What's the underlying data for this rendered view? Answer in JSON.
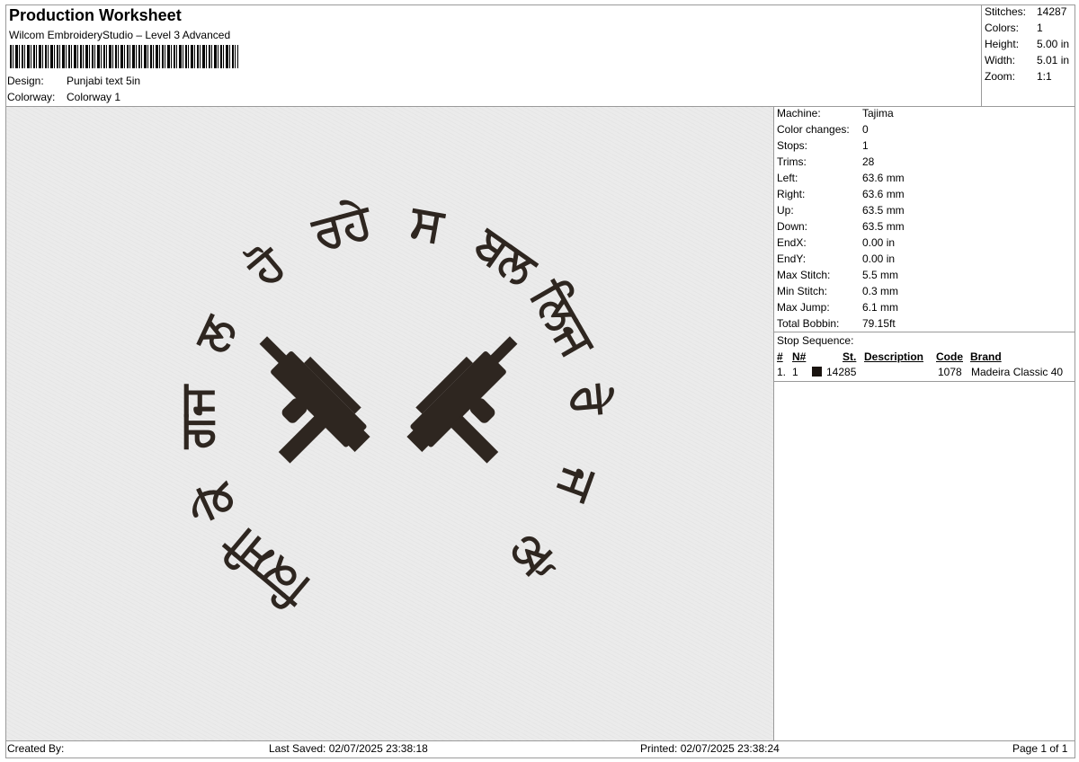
{
  "header": {
    "title": "Production Worksheet",
    "subtitle": "Wilcom EmbroideryStudio – Level 3 Advanced",
    "design_label": "Design:",
    "design_value": "Punjabi text 5in",
    "colorway_label": "Colorway:",
    "colorway_value": "Colorway 1"
  },
  "summary": [
    {
      "label": "Stitches:",
      "value": "14287"
    },
    {
      "label": "Colors:",
      "value": "1"
    },
    {
      "label": "Height:",
      "value": "5.00 in"
    },
    {
      "label": "Width:",
      "value": "5.01 in"
    },
    {
      "label": "Zoom:",
      "value": "1:1"
    }
  ],
  "machine": [
    {
      "label": "Machine:",
      "value": "Tajima"
    },
    {
      "label": "Color changes:",
      "value": "0"
    },
    {
      "label": "Stops:",
      "value": "1"
    },
    {
      "label": "Trims:",
      "value": "28"
    },
    {
      "label": "Left:",
      "value": "63.6 mm"
    },
    {
      "label": "Right:",
      "value": "63.6 mm"
    },
    {
      "label": "Up:",
      "value": "63.5 mm"
    },
    {
      "label": "Down:",
      "value": "63.5 mm"
    },
    {
      "label": "EndX:",
      "value": "0.00 in"
    },
    {
      "label": "EndY:",
      "value": "0.00 in"
    },
    {
      "label": "Max Stitch:",
      "value": "5.5 mm"
    },
    {
      "label": "Min Stitch:",
      "value": "0.3 mm"
    },
    {
      "label": "Max Jump:",
      "value": "6.1 mm"
    },
    {
      "label": "Total Bobbin:",
      "value": "79.15ft"
    }
  ],
  "stop_sequence": {
    "title": "Stop Sequence:",
    "columns": [
      "#",
      "N#",
      "St.",
      "Description",
      "Code",
      "Brand"
    ],
    "rows": [
      {
        "index": "1.",
        "n": "1",
        "color": "#1a1410",
        "stitches": "14285",
        "description": "",
        "code": "1078",
        "brand": "Madeira Classic 40"
      }
    ]
  },
  "design": {
    "thread_color": "#2e2620",
    "ring_words": [
      "ਕਿਸੀ",
      "ਕੇ",
      "ਗਜ",
      "ਲ",
      "ਹੋ",
      "ਰਹੇ",
      "ਸ",
      "ਬਲ",
      "ਲਿਜ",
      "ਰੇ",
      "ਜ",
      "ਲੋ"
    ]
  },
  "footer": {
    "created_by": "Created By:",
    "last_saved": "Last Saved: 02/07/2025 23:38:18",
    "printed": "Printed: 02/07/2025 23:38:24",
    "page": "Page 1 of 1"
  }
}
